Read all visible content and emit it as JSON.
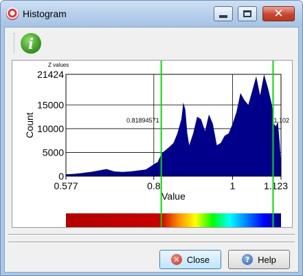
{
  "window": {
    "title": "Histogram"
  },
  "toolbar": {
    "info_icon": "info-icon"
  },
  "chart_data": {
    "type": "area",
    "title": "Z values",
    "xlabel": "Value",
    "ylabel": "Count",
    "xlim": [
      0.577,
      1.123
    ],
    "ylim": [
      0,
      21424
    ],
    "x_ticks": [
      "0.577",
      "0.8",
      "1",
      "1.123"
    ],
    "y_ticks": [
      "21424",
      "15000",
      "10000",
      "5000",
      "0"
    ],
    "color": "#00008b",
    "grid": true,
    "x": [
      0.577,
      0.6,
      0.62,
      0.64,
      0.66,
      0.68,
      0.7,
      0.72,
      0.74,
      0.76,
      0.78,
      0.8,
      0.81,
      0.82,
      0.83,
      0.84,
      0.85,
      0.86,
      0.87,
      0.875,
      0.88,
      0.885,
      0.89,
      0.9,
      0.91,
      0.92,
      0.93,
      0.94,
      0.95,
      0.96,
      0.97,
      0.98,
      0.99,
      1.0,
      1.01,
      1.02,
      1.03,
      1.04,
      1.05,
      1.06,
      1.07,
      1.08,
      1.09,
      1.1,
      1.105,
      1.11,
      1.115,
      1.12,
      1.123
    ],
    "values": [
      400,
      500,
      700,
      900,
      1200,
      1500,
      1000,
      900,
      1000,
      1200,
      1400,
      2500,
      3000,
      4800,
      5500,
      6200,
      7000,
      9000,
      12000,
      15500,
      14000,
      9000,
      6500,
      9000,
      12500,
      12000,
      9500,
      13000,
      11000,
      6500,
      7000,
      8500,
      9000,
      11000,
      13500,
      17500,
      16000,
      15000,
      18000,
      21000,
      17000,
      21424,
      18500,
      15000,
      11000,
      10500,
      11500,
      6500,
      2500
    ],
    "markers": [
      {
        "x": 0.8189,
        "label": "0.81894571",
        "color": "#00e000"
      },
      {
        "x": 1.1029,
        "label": "1.102",
        "color": "#00e000"
      }
    ]
  },
  "colorbar": {
    "stops": [
      "#b40000",
      "#c80000",
      "#ff8c00",
      "#ffff00",
      "#00ff00",
      "#00ffff",
      "#0080ff",
      "#0000ff",
      "#00008b"
    ]
  },
  "buttons": {
    "close_label": "Close",
    "help_label": "Help",
    "close_icon": "close-icon",
    "help_icon": "help-icon"
  }
}
